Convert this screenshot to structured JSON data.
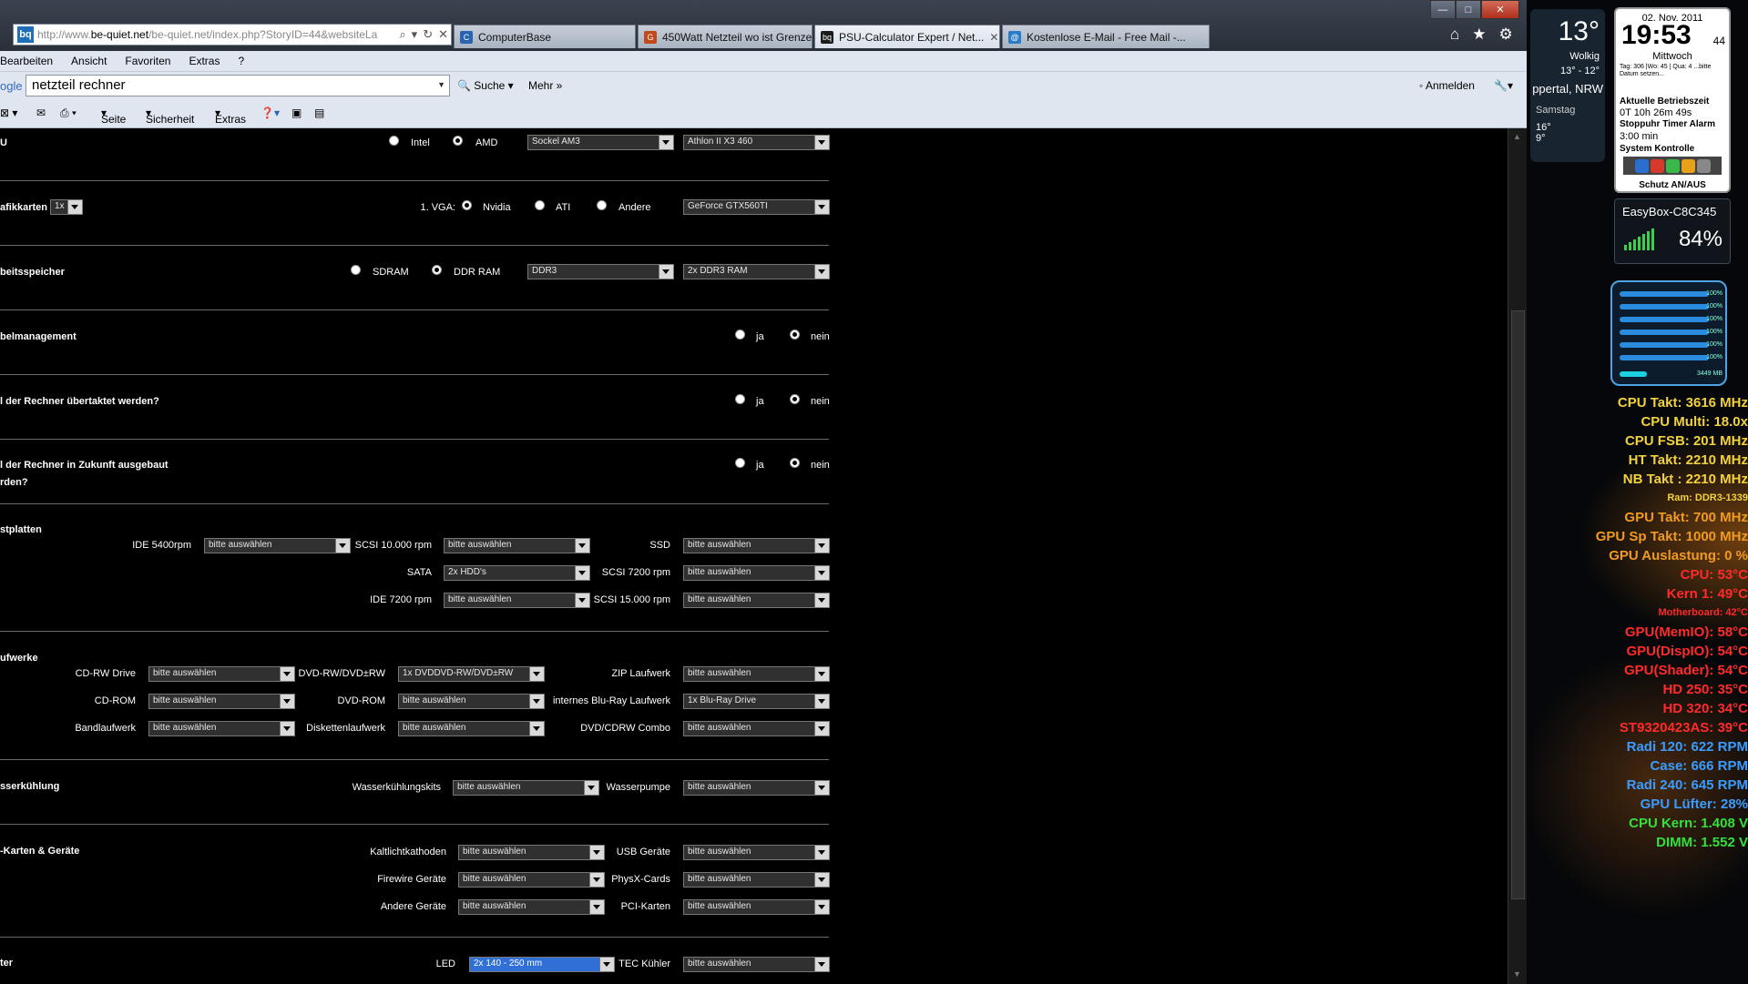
{
  "browser": {
    "url_prefix": "http://www.",
    "url_domain": "be-quiet.net",
    "url_rest": "/be-quiet.net/index.php?StoryID=44&websiteLa",
    "tabs": [
      {
        "label": "ComputerBase",
        "active": false
      },
      {
        "label": "450Watt Netzteil wo ist Grenze...",
        "active": false
      },
      {
        "label": "PSU-Calculator Expert / Net...",
        "active": true
      },
      {
        "label": "Kostenlose E-Mail - Free Mail -...",
        "active": false
      }
    ],
    "menu": [
      "Bearbeiten",
      "Ansicht",
      "Favoriten",
      "Extras",
      "?"
    ],
    "google": {
      "logo": "ogle",
      "query": "netzteil rechner",
      "search_label": "Suche",
      "more_label": "Mehr",
      "signin_label": "Anmelden"
    },
    "commands": [
      "Seite",
      "Sicherheit",
      "Extras"
    ]
  },
  "form": {
    "cpu": {
      "title": "U",
      "intel": "Intel",
      "amd": "AMD",
      "socket": "Sockel AM3",
      "model": "Athlon II X3 460"
    },
    "gpu": {
      "title": "afikkarten",
      "count": "1x",
      "vga_label": "1. VGA:",
      "nvidia": "Nvidia",
      "ati": "ATI",
      "other": "Andere",
      "model": "GeForce GTX560TI"
    },
    "ram": {
      "title": "beitsspeicher",
      "sdram": "SDRAM",
      "ddr": "DDR RAM",
      "type": "DDR3",
      "amount": "2x DDR3 RAM"
    },
    "cable": {
      "title": "belmanagement",
      "yes": "ja",
      "no": "nein"
    },
    "oc": {
      "title": "l der Rechner übertaktet werden?",
      "yes": "ja",
      "no": "nein"
    },
    "future": {
      "title1": "l der Rechner in Zukunft ausgebaut",
      "title2": "rden?",
      "yes": "ja",
      "no": "nein"
    },
    "hdd": {
      "title": "stplatten",
      "ide5400_label": "IDE 5400rpm",
      "ide5400": "bitte auswählen",
      "scsi10k_label": "SCSI 10.000 rpm",
      "scsi10k": "bitte auswählen",
      "ssd_label": "SSD",
      "ssd": "bitte auswählen",
      "sata_label": "SATA",
      "sata": "2x HDD's",
      "scsi7200_label": "SCSI 7200 rpm",
      "scsi7200": "bitte auswählen",
      "ide7200_label": "IDE 7200 rpm",
      "ide7200": "bitte auswählen",
      "scsi15k_label": "SCSI 15.000 rpm",
      "scsi15k": "bitte auswählen"
    },
    "drives": {
      "title": "ufwerke",
      "cdrw_label": "CD-RW Drive",
      "cdrw": "bitte auswählen",
      "dvdrw_label": "DVD-RW/DVD±RW",
      "dvdrw": "1x DVDDVD-RW/DVD±RW",
      "zip_label": "ZIP Laufwerk",
      "zip": "bitte auswählen",
      "cdrom_label": "CD-ROM",
      "cdrom": "bitte auswählen",
      "dvdrom_label": "DVD-ROM",
      "dvdrom": "bitte auswählen",
      "bluray_label": "internes Blu-Ray Laufwerk",
      "bluray": "1x Blu-Ray Drive",
      "tape_label": "Bandlaufwerk",
      "tape": "bitte auswählen",
      "floppy_label": "Diskettenlaufwerk",
      "floppy": "bitte auswählen",
      "combo_label": "DVD/CDRW Combo",
      "combo": "bitte auswählen"
    },
    "water": {
      "title": "sserkühlung",
      "kits_label": "Wasserkühlungskits",
      "kits": "bitte auswählen",
      "pump_label": "Wasserpumpe",
      "pump": "bitte auswählen"
    },
    "cards": {
      "title": "-Karten & Geräte",
      "ccfl_label": "Kaltlichtkathoden",
      "ccfl": "bitte auswählen",
      "usb_label": "USB Geräte",
      "usb": "bitte auswählen",
      "firewire_label": "Firewire Geräte",
      "firewire": "bitte auswählen",
      "physx_label": "PhysX-Cards",
      "physx": "bitte auswählen",
      "other_label": "Andere Geräte",
      "other": "bitte auswählen",
      "pci_label": "PCI-Karten",
      "pci": "bitte auswählen"
    },
    "fans": {
      "title": "ter",
      "led_label": "LED",
      "led": "2x 140 - 250 mm",
      "tec_label": "TEC Kühler",
      "tec": "bitte auswählen"
    }
  },
  "gadgets": {
    "weather": {
      "temp": "13°",
      "cond": "Wolkig",
      "range": "13° - 12°",
      "city": "ppertal, NRW",
      "fc_day": "Samstag",
      "fc_hi": "16°",
      "fc_lo": "9°"
    },
    "clock": {
      "date": "02. Nov. 2011",
      "time": "19:53",
      "seconds": "44",
      "weekday": "Mittwoch",
      "info": "Tag: 306 |Wo: 45 | Qua: 4 ...bitte Datum setzen...",
      "uptime_label": "Aktuelle Betriebszeit",
      "uptime": "0T 10h 26m 49s",
      "stopwatch_label": "Stoppuhr Timer Alarm",
      "stopwatch": "3:00 min",
      "syscontrol_label": "System Kontrolle",
      "protect_label": "Schutz AN/AUS"
    },
    "wifi": {
      "name": "EasyBox-C8C345",
      "percent": "84%"
    },
    "meter": {
      "levels": [
        "100%",
        "100%",
        "100%",
        "100%",
        "100%",
        "100%"
      ],
      "mem": "3449 MB"
    },
    "stats": [
      {
        "text": "CPU Takt: 3616 MHz",
        "color": "#f2d23a"
      },
      {
        "text": "CPU Multi: 18.0x",
        "color": "#f2d23a"
      },
      {
        "text": "CPU FSB: 201 MHz",
        "color": "#f2d23a"
      },
      {
        "text": "HT Takt: 2210 MHz",
        "color": "#f2d23a"
      },
      {
        "text": "NB Takt : 2210 MHz",
        "color": "#f2d23a"
      },
      {
        "text": "Ram: DDR3-1339",
        "color": "#f2d23a",
        "small": true
      },
      {
        "text": "GPU Takt: 700 MHz",
        "color": "#f09a20"
      },
      {
        "text": "GPU Sp Takt: 1000 MHz",
        "color": "#f09a20"
      },
      {
        "text": "GPU Auslastung: 0 %",
        "color": "#f09a20"
      },
      {
        "text": "CPU: 53°C",
        "color": "#ff2a2a"
      },
      {
        "text": "Kern 1: 49°C",
        "color": "#ff2a2a"
      },
      {
        "text": "Motherboard: 42°C",
        "color": "#ff2a2a",
        "small": true
      },
      {
        "text": "GPU(MemIO): 58°C",
        "color": "#ff2a2a"
      },
      {
        "text": "GPU(DispIO): 54°C",
        "color": "#ff2a2a"
      },
      {
        "text": "GPU(Shader): 54°C",
        "color": "#ff2a2a"
      },
      {
        "text": "HD 250: 35°C",
        "color": "#ff2a2a"
      },
      {
        "text": "HD 320: 34°C",
        "color": "#ff2a2a"
      },
      {
        "text": "ST9320423AS: 39°C",
        "color": "#ff2a2a"
      },
      {
        "text": "Radi 120: 622 RPM",
        "color": "#3a9cff"
      },
      {
        "text": "Case: 666 RPM",
        "color": "#3a9cff"
      },
      {
        "text": "Radi 240: 645 RPM",
        "color": "#3a9cff"
      },
      {
        "text": "GPU Lüfter: 28%",
        "color": "#3a9cff"
      },
      {
        "text": "CPU Kern: 1.408 V",
        "color": "#34e03a"
      },
      {
        "text": "DIMM: 1.552 V",
        "color": "#34e03a"
      }
    ]
  }
}
